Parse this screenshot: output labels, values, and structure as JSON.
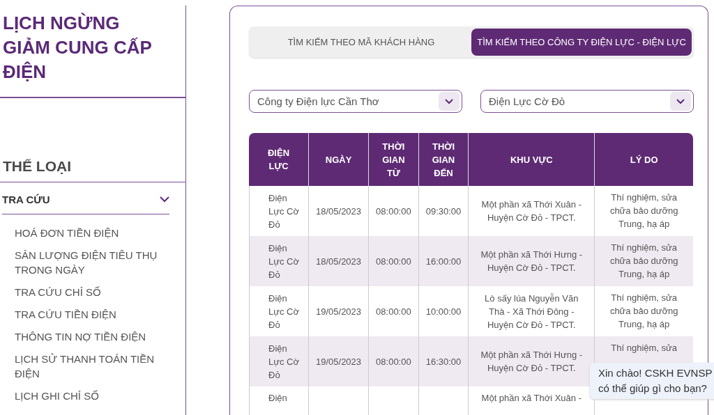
{
  "sidebar": {
    "title": "LỊCH NGỪNG GIẢM CUNG CẤP ĐIỆN",
    "category_heading": "THỂ LOẠI",
    "group": {
      "label": "TRA CỨU",
      "expanded": true,
      "items": [
        {
          "label": "HOÁ ĐƠN TIỀN ĐIỆN"
        },
        {
          "label": "SẢN LƯỢNG ĐIỆN TIÊU THỤ TRONG NGÀY"
        },
        {
          "label": "TRA CỨU CHỈ SỐ"
        },
        {
          "label": "TRA CỨU TIỀN ĐIỆN"
        },
        {
          "label": "THÔNG TIN NỢ TIỀN ĐIỆN"
        },
        {
          "label": "LỊCH SỬ THANH TOÁN TIỀN ĐIỆN"
        },
        {
          "label": "LỊCH GHI CHỈ SỐ"
        }
      ]
    }
  },
  "tabs": [
    {
      "label": "TÌM KIẾM THEO MÃ KHÁCH HÀNG",
      "selected": false
    },
    {
      "label": "TÌM KIẾM THEO CÔNG TY ĐIỆN LỰC - ĐIỆN LỰC",
      "selected": true
    }
  ],
  "filters": [
    {
      "value": "Công ty Điện lực Cần Thơ"
    },
    {
      "value": "Điện Lực Cờ Đỏ"
    }
  ],
  "table": {
    "columns": [
      "ĐIỆN LỰC",
      "NGÀY",
      "THỜI GIAN TỪ",
      "THỜI GIAN ĐẾN",
      "KHU VỰC",
      "LÝ DO"
    ],
    "rows": [
      {
        "unit": "Điện Lực Cờ Đỏ",
        "date": "18/05/2023",
        "from": "08:00:00",
        "to": "09:30:00",
        "area": "Một phần xã Thới Xuân - Huyện Cờ Đỏ - TPCT.",
        "reason": "Thí nghiệm, sửa chữa bảo dưỡng Trung, hạ áp"
      },
      {
        "unit": "Điện Lực Cờ Đỏ",
        "date": "18/05/2023",
        "from": "08:00:00",
        "to": "16:00:00",
        "area": "Một phần xã Thới Hưng - Huyện Cờ Đỏ - TPCT.",
        "reason": "Thí nghiệm, sửa chữa bảo dưỡng Trung, hạ áp"
      },
      {
        "unit": "Điện Lực Cờ Đỏ",
        "date": "19/05/2023",
        "from": "08:00:00",
        "to": "10:00:00",
        "area": "Lò sấy lúa Nguyễn Văn Thà - Xã Thới Đông - Huyện Cờ Đỏ - TPCT.",
        "reason": "Thí nghiệm, sửa chữa bảo dưỡng Trung, hạ áp"
      },
      {
        "unit": "Điện Lực Cờ Đỏ",
        "date": "19/05/2023",
        "from": "08:00:00",
        "to": "16:30:00",
        "area": "Một phần xã Thới Hưng - Huyện Cờ Đỏ - TPCT.",
        "reason": "Thí nghiệm, sửa"
      },
      {
        "unit": "Điện",
        "area": "Một phần xã Thới Xuân -"
      }
    ]
  },
  "chat_bubble": {
    "lines": [
      "Xin chào! CSKH EVNSP",
      "có thể giúp gì cho bạn?"
    ]
  }
}
